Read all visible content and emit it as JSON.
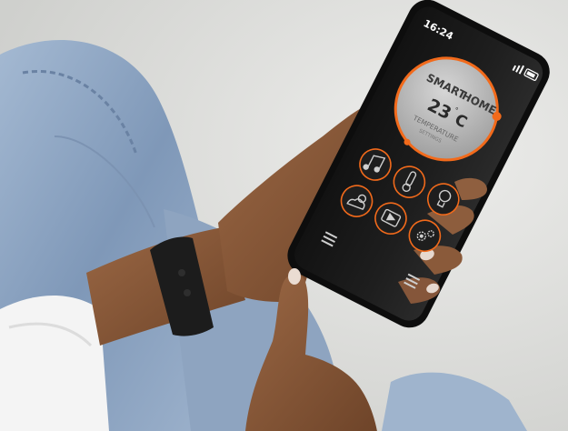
{
  "status_bar": {
    "time": "16:24"
  },
  "app": {
    "title_part1": "SMART",
    "title_part2": "HOME",
    "temperature_value": "23",
    "temperature_unit": "C",
    "temperature_label": "TEMPERATURE",
    "temperature_sublabel": "SETTINGS"
  },
  "colors": {
    "accent": "#f26a1b",
    "screen": "#1b1b1b",
    "dial_face": "#bdbdbd",
    "jeans": "#8fa6c2",
    "sleeve": "#f4f4f4",
    "skin": "#8a5a3a",
    "watch": "#1c1c1c"
  },
  "icons": [
    "music-notes-icon",
    "thermometer-icon",
    "lightbulb-icon",
    "weather-icon",
    "play-video-icon",
    "gears-icon",
    "menu-icon"
  ]
}
